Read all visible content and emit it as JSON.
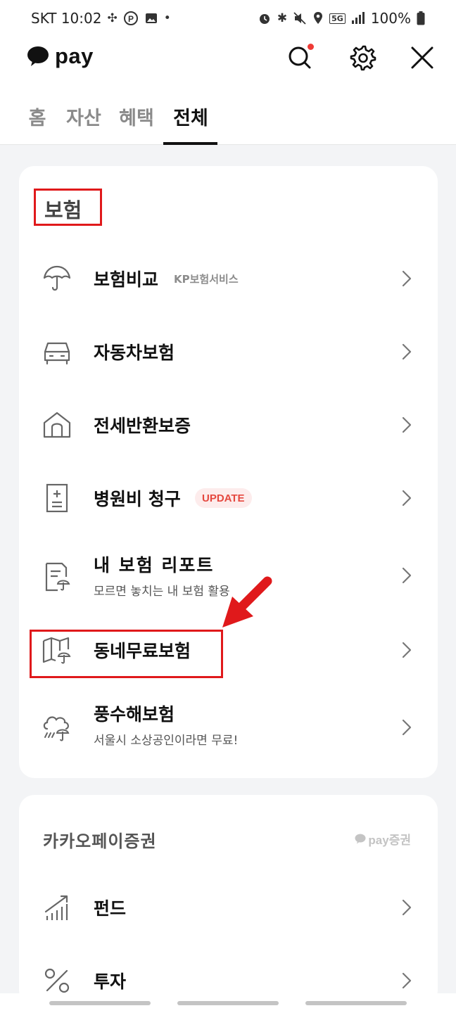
{
  "status_bar": {
    "carrier_time": "SKT 10:02",
    "battery": "100%",
    "network": "5G"
  },
  "header": {
    "logo_text": "pay"
  },
  "tabs": [
    {
      "label": "홈",
      "active": false
    },
    {
      "label": "자산",
      "active": false
    },
    {
      "label": "혜택",
      "active": false
    },
    {
      "label": "전체",
      "active": true
    }
  ],
  "insurance": {
    "title": "보험",
    "items": [
      {
        "title": "보험비교",
        "tag": "KP보험서비스",
        "icon": "umbrella-icon"
      },
      {
        "title": "자동차보험",
        "icon": "car-icon"
      },
      {
        "title": "전세반환보증",
        "icon": "house-icon"
      },
      {
        "title": "병원비 청구",
        "badge": "UPDATE",
        "icon": "hospital-document-icon"
      },
      {
        "title": "내 보험 리포트",
        "subtitle": "모르면 놓치는 내 보험 활용",
        "icon": "report-umbrella-icon"
      },
      {
        "title": "동네무료보험",
        "icon": "map-umbrella-icon"
      },
      {
        "title": "풍수해보험",
        "subtitle": "서울시 소상공인이라면 무료!",
        "icon": "storm-umbrella-icon"
      }
    ]
  },
  "securities": {
    "title": "카카오페이증권",
    "brand_label": "pay증권",
    "items": [
      {
        "title": "펀드",
        "icon": "fund-chart-icon"
      },
      {
        "title": "투자",
        "icon": "percent-icon"
      }
    ]
  },
  "colors": {
    "highlight": "#e0191b",
    "badge_bg": "#fdecec",
    "badge_text": "#e5483f",
    "background": "#f3f4f6"
  }
}
